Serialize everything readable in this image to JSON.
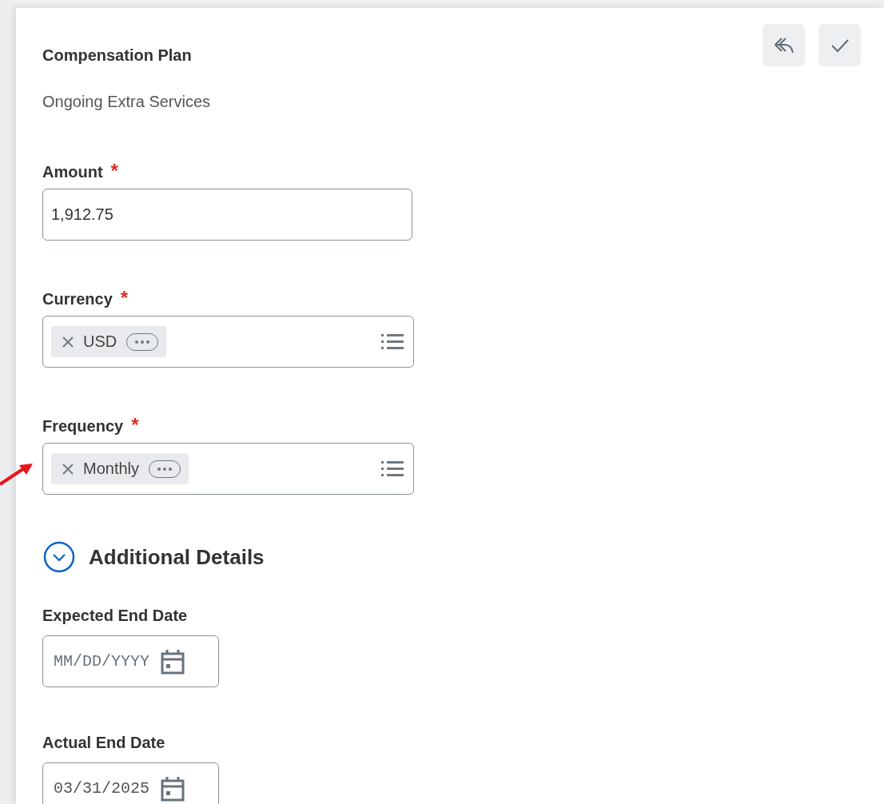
{
  "header": {
    "title": "Compensation Plan",
    "subtitle": "Ongoing Extra Services"
  },
  "actions": [
    {
      "kind": "cancel"
    },
    {
      "kind": "submit"
    }
  ],
  "fields": [
    {
      "kind": "text",
      "label": "Amount",
      "required_mark": "*",
      "value": "1,912.75"
    },
    {
      "kind": "prompt",
      "label": "Currency",
      "required_mark": "*",
      "value": "USD"
    },
    {
      "kind": "prompt",
      "label": "Frequency",
      "required_mark": "*",
      "value": "Monthly"
    }
  ],
  "section": {
    "title": "Additional Details",
    "expanded": true,
    "fields": [
      {
        "kind": "date",
        "label": "Expected End Date",
        "placeholder": "MM/DD/YYYY"
      },
      {
        "kind": "date",
        "label": "Actual End Date",
        "value": "03/31/2025"
      }
    ]
  }
}
